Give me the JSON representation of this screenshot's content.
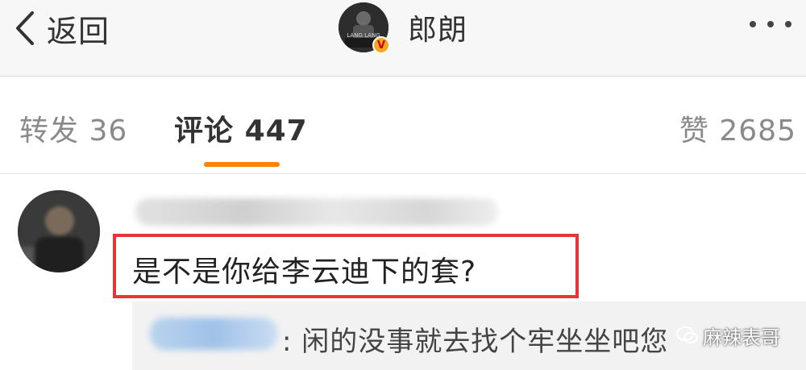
{
  "header": {
    "back_label": "返回",
    "profile_name": "郎朗",
    "avatar_text": "LANG LANG",
    "verified_badge": "V"
  },
  "tabs": [
    {
      "label": "转发",
      "count": "36"
    },
    {
      "label": "评论",
      "count": "447"
    },
    {
      "label": "赞",
      "count": "2685"
    }
  ],
  "active_tab_color": "#ff8200",
  "comment": {
    "text": "是不是你给李云迪下的套?",
    "highlight_color": "#e8333a",
    "reply": {
      "text": ": 闲的没事就去找个牢坐坐吧您"
    }
  },
  "watermark": {
    "text": "麻辣表哥"
  }
}
